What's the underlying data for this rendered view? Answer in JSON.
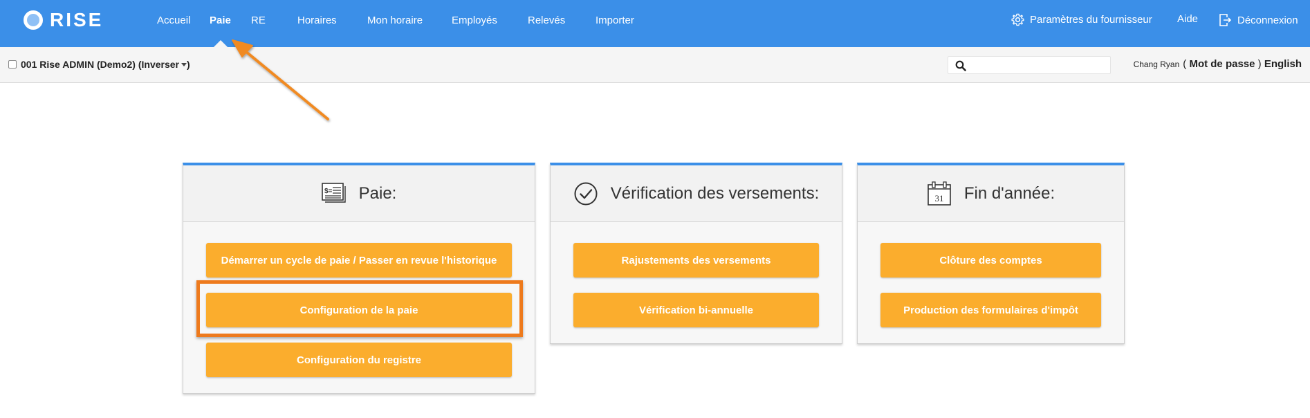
{
  "brand": {
    "name": "RISE"
  },
  "nav": {
    "items": [
      {
        "label": "Accueil",
        "active": false
      },
      {
        "label": "Paie",
        "active": true
      },
      {
        "label": "RE",
        "active": false
      },
      {
        "label": "Horaires",
        "active": false
      },
      {
        "label": "Mon horaire",
        "active": false
      },
      {
        "label": "Employés",
        "active": false
      },
      {
        "label": "Relevés",
        "active": false
      },
      {
        "label": "Importer",
        "active": false
      }
    ],
    "supplier_settings": "Paramètres du fournisseur",
    "help": "Aide",
    "logout": "Déconnexion"
  },
  "subbar": {
    "company": "001 Rise ADMIN (Demo2) (Inverser",
    "search_placeholder": "",
    "user_name": "Chang Ryan",
    "open_paren": "(",
    "password_link": "Mot de passe",
    "close_paren": ")",
    "language_link": "English"
  },
  "cards": [
    {
      "title": "Paie:",
      "icon": "pay-stub-icon",
      "buttons": [
        "Démarrer un cycle de paie / Passer en revue l'historique",
        "Configuration de la paie",
        "Configuration du registre"
      ]
    },
    {
      "title": "Vérification des versements:",
      "icon": "checkmark-circle-icon",
      "buttons": [
        "Rajustements des versements",
        "Vérification bi-annuelle"
      ]
    },
    {
      "title": "Fin d'année:",
      "icon": "calendar-icon",
      "calendar_day": "31",
      "buttons": [
        "Clôture des comptes",
        "Production des formulaires d'impôt"
      ]
    }
  ],
  "colors": {
    "topbar": "#3b8fe8",
    "button": "#fbad2d",
    "highlight": "#ee7a1c",
    "arrow": "#f08a24"
  }
}
